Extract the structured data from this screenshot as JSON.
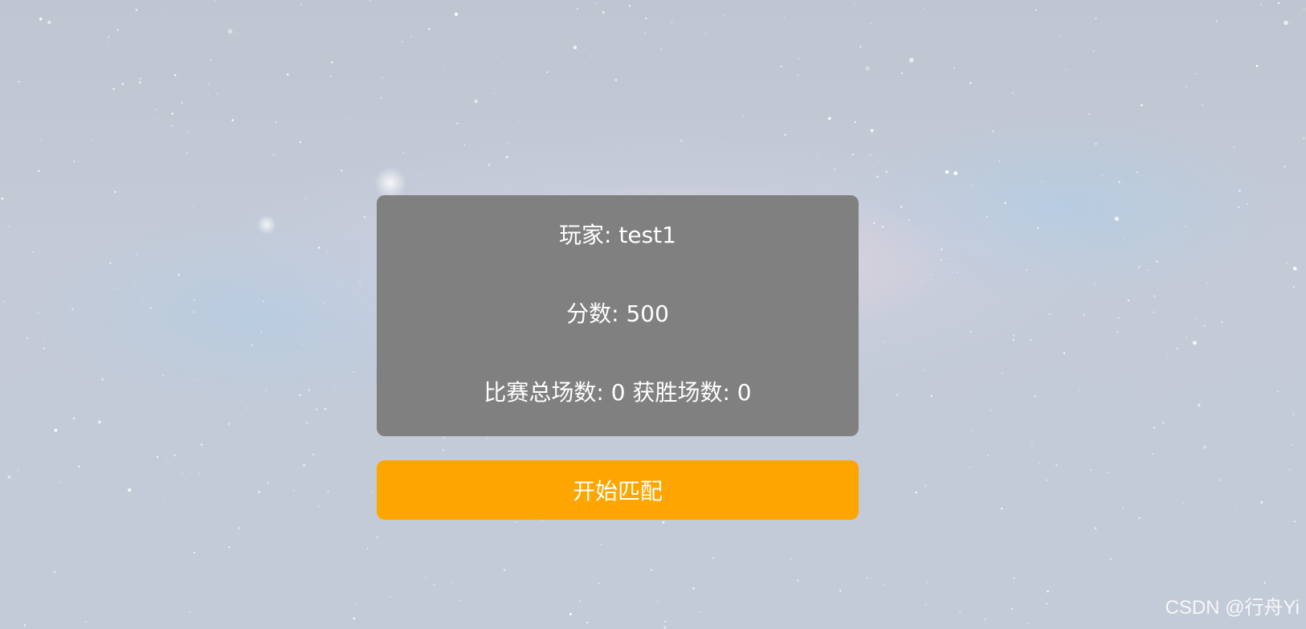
{
  "player": {
    "label": "玩家: test1",
    "name": "test1"
  },
  "score": {
    "label": "分数: 500",
    "value": 500
  },
  "stats": {
    "label": "比赛总场数: 0 获胜场数: 0",
    "total_matches": 0,
    "wins": 0
  },
  "match_button": {
    "label": "开始匹配"
  },
  "watermark": {
    "text": "CSDN @行舟Yi"
  },
  "colors": {
    "card_background": "#808080",
    "button_background": "#ffa500",
    "text": "#ffffff"
  }
}
